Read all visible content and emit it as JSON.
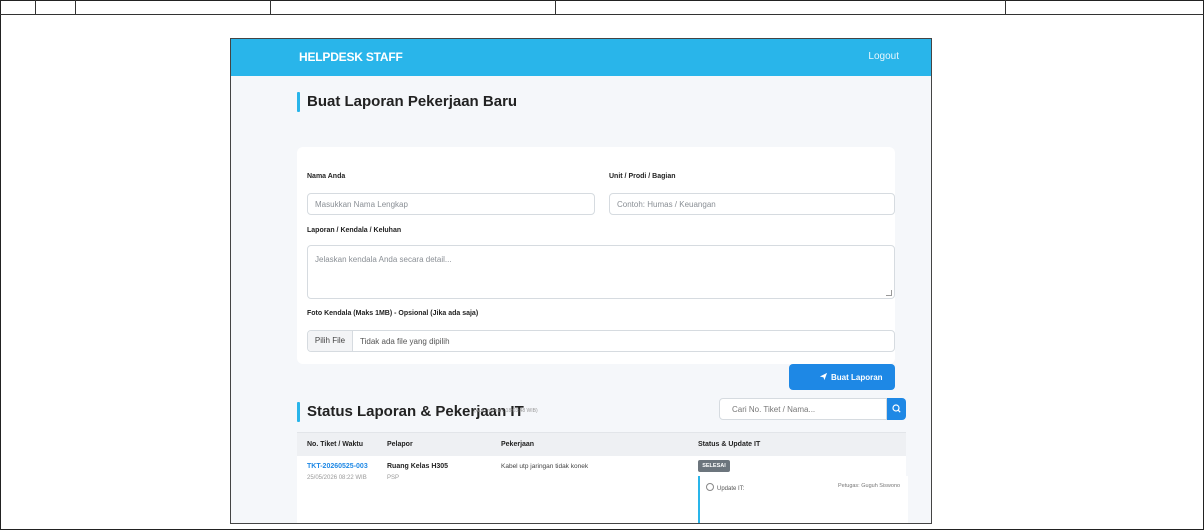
{
  "navbar": {
    "brand": "HELPDESK STAFF",
    "logout": "Logout"
  },
  "form": {
    "title": "Buat Laporan Pekerjaan Baru",
    "name_label": "Nama Anda",
    "name_placeholder": "Masukkan Nama Lengkap",
    "unit_label": "Unit / Prodi / Bagian",
    "unit_placeholder": "Contoh: Humas / Keuangan",
    "report_label": "Laporan / Kendala / Keluhan",
    "report_placeholder": "Jelaskan kendala Anda secara detail...",
    "photo_label": "Foto Kendala (Maks 1MB) - Opsional (Jika ada saja)",
    "file_button": "Pilih File",
    "file_status": "Tidak ada file yang dipilih",
    "submit_icon": "paper-plane-icon",
    "submit_label": "Buat Laporan"
  },
  "status": {
    "title": "Status Laporan & Pekerjaan IT",
    "auto_refresh": "(Auto refresh: 18:03:48 WIB)",
    "search_placeholder": "Cari No. Tiket / Nama...",
    "search_icon": "search-icon",
    "columns": [
      "No. Tiket / Waktu",
      "Pelapor",
      "Pekerjaan",
      "Status & Update IT"
    ],
    "rows": [
      {
        "ticket": "TKT-20260525-003",
        "time": "25/05/2026 08:22 WIB",
        "reporter": "Ruang Kelas H305",
        "reporter_sub": "PSP",
        "job": "Kabel utp jaringan tidak konek",
        "status": "SELESAI",
        "update_label": "Update IT:",
        "update_by": "Petugas: Guguh Siswono"
      }
    ]
  },
  "colors": {
    "accent": "#29b5ea",
    "primary": "#1e88e5",
    "badge": "#6c757d"
  }
}
